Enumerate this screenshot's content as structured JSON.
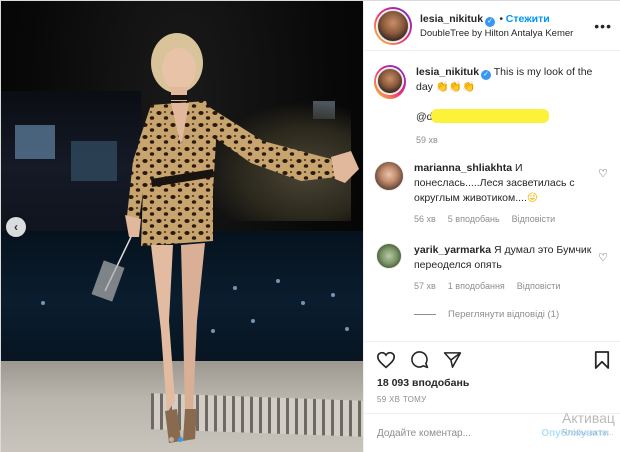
{
  "header": {
    "username": "lesia_nikituk",
    "follow_label": "Стежити",
    "location": "DoubleTree by Hilton Antalya Kemer",
    "verified_glyph": "✓",
    "more_icon": "more-horizontal-icon"
  },
  "caption": {
    "username": "lesia_nikituk",
    "text": "This is my look of the day",
    "emoji": "👏👏👏",
    "mention_prefix": "@d",
    "time": "59 хв"
  },
  "comments": [
    {
      "username": "marianna_shliakhta",
      "text": "И понеслась.....Леся засветилась с округлым животиком....",
      "emoji": "😜",
      "time": "56 хв",
      "likes": "5 вподобань",
      "reply_label": "Відповісти"
    },
    {
      "username": "yarik_yarmarka",
      "text": "Я думал это Бумчик переоделся опять",
      "time": "57 хв",
      "likes": "1 вподобання",
      "reply_label": "Відповісти"
    }
  ],
  "view_replies": "Переглянути відповіді (1)",
  "stats": {
    "likes": "18 093 вподобань",
    "time_ago": "59 ХВ ТОМУ"
  },
  "add_comment": {
    "placeholder": "Додайте коментар...",
    "publish_label": "Опублікувати"
  },
  "carousel": {
    "total": 2,
    "active": 2
  },
  "watermark": {
    "title": "Активац",
    "subtitle": "Чтобы акти..."
  },
  "colors": {
    "accent": "#0095f6",
    "verified": "#3897f0",
    "highlight": "#fdf23a",
    "publish_disabled": "#b2dffc"
  }
}
